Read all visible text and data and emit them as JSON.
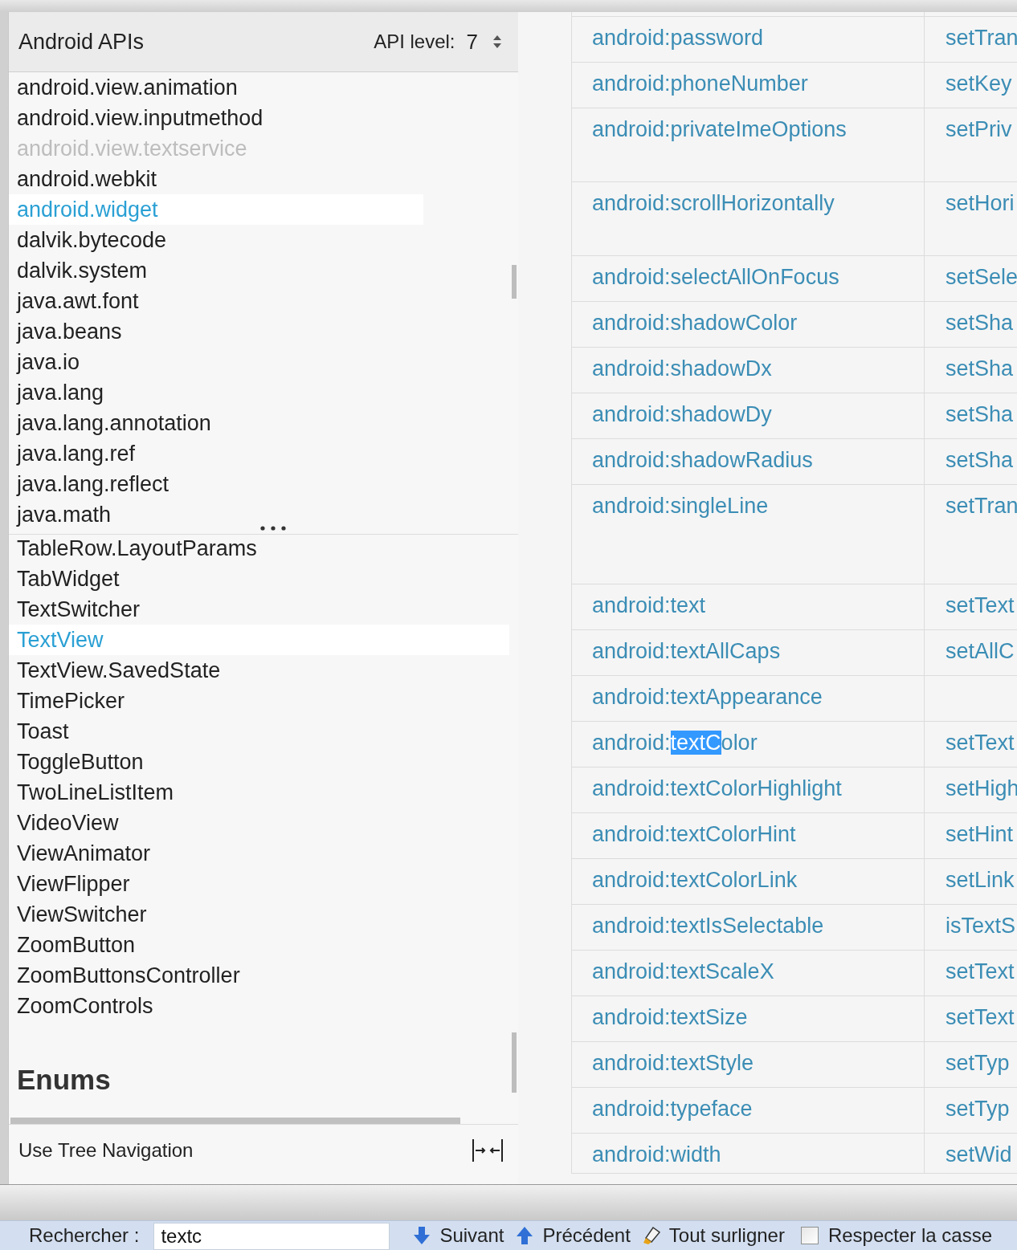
{
  "header": {
    "title": "Android APIs",
    "api_level_label": "API level:",
    "api_level": "7"
  },
  "packages": [
    {
      "label": "android.view.animation",
      "selected": false,
      "disabled": false
    },
    {
      "label": "android.view.inputmethod",
      "selected": false,
      "disabled": false
    },
    {
      "label": "android.view.textservice",
      "selected": false,
      "disabled": true
    },
    {
      "label": "android.webkit",
      "selected": false,
      "disabled": false
    },
    {
      "label": "android.widget",
      "selected": true,
      "disabled": false
    },
    {
      "label": "dalvik.bytecode",
      "selected": false,
      "disabled": false
    },
    {
      "label": "dalvik.system",
      "selected": false,
      "disabled": false
    },
    {
      "label": "java.awt.font",
      "selected": false,
      "disabled": false
    },
    {
      "label": "java.beans",
      "selected": false,
      "disabled": false
    },
    {
      "label": "java.io",
      "selected": false,
      "disabled": false
    },
    {
      "label": "java.lang",
      "selected": false,
      "disabled": false
    },
    {
      "label": "java.lang.annotation",
      "selected": false,
      "disabled": false
    },
    {
      "label": "java.lang.ref",
      "selected": false,
      "disabled": false
    },
    {
      "label": "java.lang.reflect",
      "selected": false,
      "disabled": false
    },
    {
      "label": "java.math",
      "selected": false,
      "disabled": false
    }
  ],
  "classes": [
    {
      "label": "TableRow.LayoutParams",
      "selected": false
    },
    {
      "label": "TabWidget",
      "selected": false
    },
    {
      "label": "TextSwitcher",
      "selected": false
    },
    {
      "label": "TextView",
      "selected": true
    },
    {
      "label": "TextView.SavedState",
      "selected": false
    },
    {
      "label": "TimePicker",
      "selected": false
    },
    {
      "label": "Toast",
      "selected": false
    },
    {
      "label": "ToggleButton",
      "selected": false
    },
    {
      "label": "TwoLineListItem",
      "selected": false
    },
    {
      "label": "VideoView",
      "selected": false
    },
    {
      "label": "ViewAnimator",
      "selected": false
    },
    {
      "label": "ViewFlipper",
      "selected": false
    },
    {
      "label": "ViewSwitcher",
      "selected": false
    },
    {
      "label": "ZoomButton",
      "selected": false
    },
    {
      "label": "ZoomButtonsController",
      "selected": false
    },
    {
      "label": "ZoomControls",
      "selected": false
    }
  ],
  "section_heading": "Enums",
  "footer": {
    "label": "Use Tree Navigation"
  },
  "attributes_table": {
    "rows": [
      {
        "attribute": "android:password",
        "method": "setTran"
      },
      {
        "attribute": "android:phoneNumber",
        "method": "setKey"
      },
      {
        "attribute": "android:privateImeOptions",
        "method": "setPriv"
      },
      {
        "attribute": "android:scrollHorizontally",
        "method": "setHori"
      },
      {
        "attribute": "android:selectAllOnFocus",
        "method": "setSele"
      },
      {
        "attribute": "android:shadowColor",
        "method": "setSha"
      },
      {
        "attribute": "android:shadowDx",
        "method": "setSha"
      },
      {
        "attribute": "android:shadowDy",
        "method": "setSha"
      },
      {
        "attribute": "android:shadowRadius",
        "method": "setSha"
      },
      {
        "attribute": "android:singleLine",
        "method": "setTran"
      },
      {
        "attribute": "android:text",
        "method": "setText"
      },
      {
        "attribute": "android:textAllCaps",
        "method": "setAllC"
      },
      {
        "attribute": "android:textAppearance"
      },
      {
        "attribute_before": "android:",
        "attribute_match": "textC",
        "attribute_after": "olor",
        "method": "setText"
      },
      {
        "attribute": "android:textColorHighlight",
        "method": "setHigh"
      },
      {
        "attribute": "android:textColorHint",
        "method": "setHint"
      },
      {
        "attribute": "android:textColorLink",
        "method": "setLink"
      },
      {
        "attribute": "android:textIsSelectable",
        "method": "isTextS"
      },
      {
        "attribute": "android:textScaleX",
        "method": "setText"
      },
      {
        "attribute": "android:textSize",
        "method": "setText"
      },
      {
        "attribute": "android:textStyle",
        "method": "setTyp"
      },
      {
        "attribute": "android:typeface",
        "method": "setTyp"
      },
      {
        "attribute": "android:width",
        "method": "setWid"
      }
    ]
  },
  "find_bar": {
    "label": "Rechercher :",
    "query": "textc",
    "buttons": [
      {
        "kind": "next",
        "label": "Suivant"
      },
      {
        "kind": "previous",
        "label": "Précédent"
      },
      {
        "kind": "highlight_all",
        "label": "Tout surligner"
      }
    ],
    "match_case": {
      "label": "Respecter la casse",
      "checked": false
    }
  }
}
